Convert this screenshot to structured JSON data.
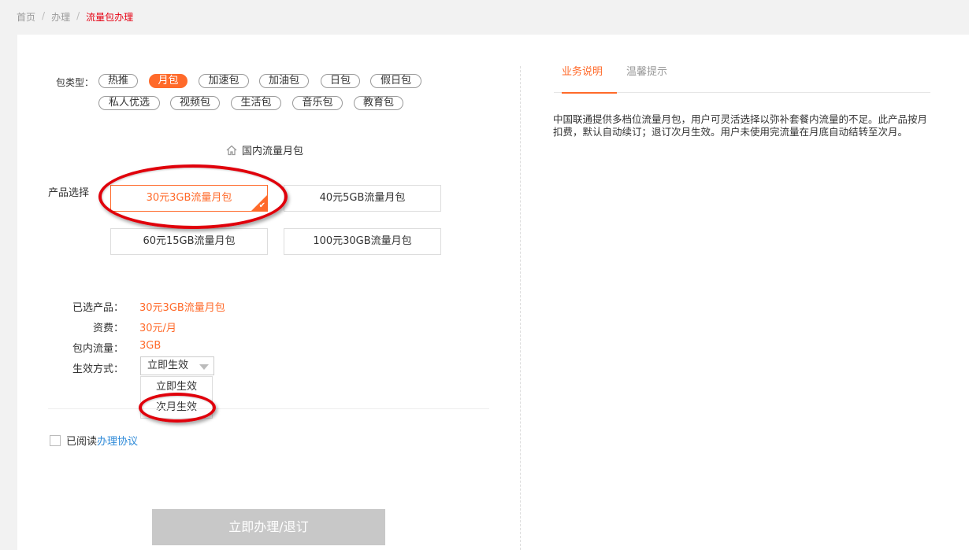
{
  "breadcrumb": {
    "home": "首页",
    "level2": "办理",
    "current": "流量包办理",
    "separator": "/"
  },
  "package_types": {
    "label": "包类型：",
    "items": [
      "热推",
      "月包",
      "加速包",
      "加油包",
      "日包",
      "假日包",
      "私人优选",
      "视频包",
      "生活包",
      "音乐包",
      "教育包"
    ],
    "active": "月包"
  },
  "section": {
    "icon": "home-icon",
    "title": "国内流量月包"
  },
  "products": {
    "label": "产品选择",
    "items": [
      "30元3GB流量月包",
      "40元5GB流量月包",
      "60元15GB流量月包",
      "100元30GB流量月包"
    ],
    "selected": "30元3GB流量月包"
  },
  "summary": {
    "selected_label": "已选产品：",
    "selected_value": "30元3GB流量月包",
    "fee_label": "资费：",
    "fee_value": "30元/月",
    "data_label": "包内流量：",
    "data_value": "3GB",
    "effect_label": "生效方式："
  },
  "effect_select": {
    "value": "立即生效",
    "options": [
      "立即生效",
      "次月生效"
    ]
  },
  "agreement": {
    "prefix": "已阅读",
    "link": "办理协议"
  },
  "submit_label": "立即办理/退订",
  "right_tabs": {
    "items": [
      "业务说明",
      "温馨提示"
    ],
    "active": "业务说明"
  },
  "description": "中国联通提供多档位流量月包，用户可灵活选择以弥补套餐内流量的不足。此产品按月扣费，默认自动续订；退订次月生效。用户未使用完流量在月底自动结转至次月。",
  "colors": {
    "accent": "#ff6a2a",
    "breadcrumb_current": "#e60012",
    "link": "#2e8ad8",
    "annotation": "#e0000b",
    "button_disabled": "#c8c8c8"
  }
}
